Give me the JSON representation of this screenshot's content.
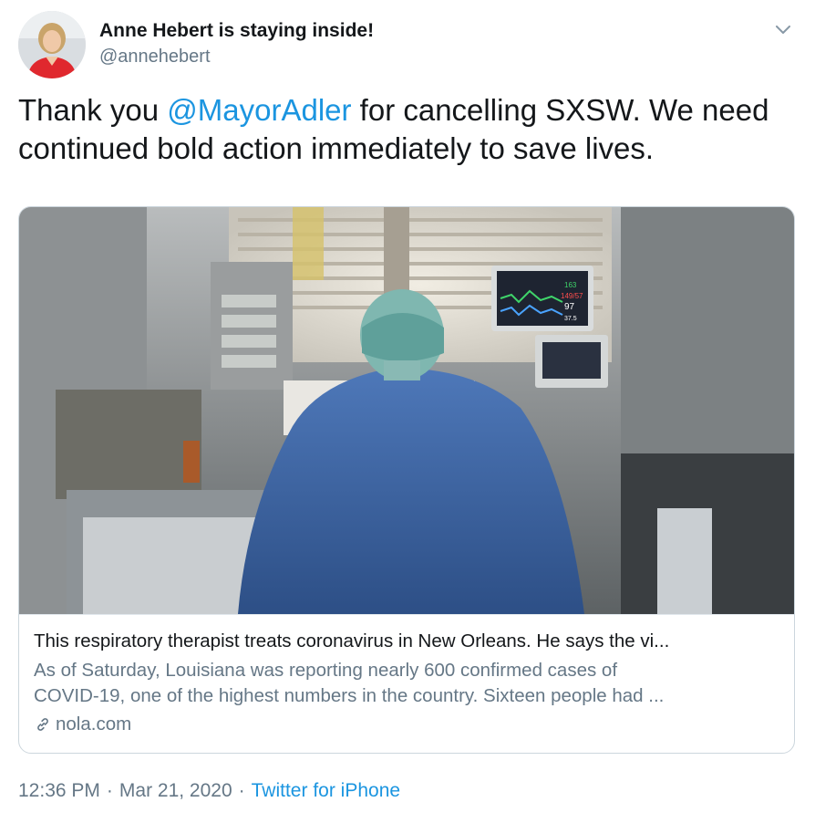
{
  "tweet": {
    "display_name": "Anne Hebert is staying inside!",
    "handle": "@annehebert",
    "text_before": "Thank you ",
    "mention": "@MayorAdler",
    "text_after": " for cancelling SXSW. We need continued bold action immediately to save lives.",
    "time": "12:36 PM",
    "date": "Mar 21, 2020",
    "source": "Twitter for iPhone",
    "separator": "·"
  },
  "card": {
    "title": "This respiratory therapist treats coronavirus in New Orleans. He says the vi...",
    "description_line1": "As of Saturday, Louisiana was reporting nearly 600 confirmed cases of",
    "description_line2": "COVID-19, one of the highest numbers in the country. Sixteen people had ...",
    "domain": "nola.com",
    "monitor_readings": [
      "163",
      "149/57",
      "97",
      "37.5"
    ]
  },
  "icons": {
    "avatar": "avatar",
    "caret": "chevron-down-icon",
    "link": "link-icon"
  },
  "colors": {
    "link_blue": "#1b95e0",
    "secondary_text": "#657786",
    "card_border": "#ccd6dd"
  }
}
